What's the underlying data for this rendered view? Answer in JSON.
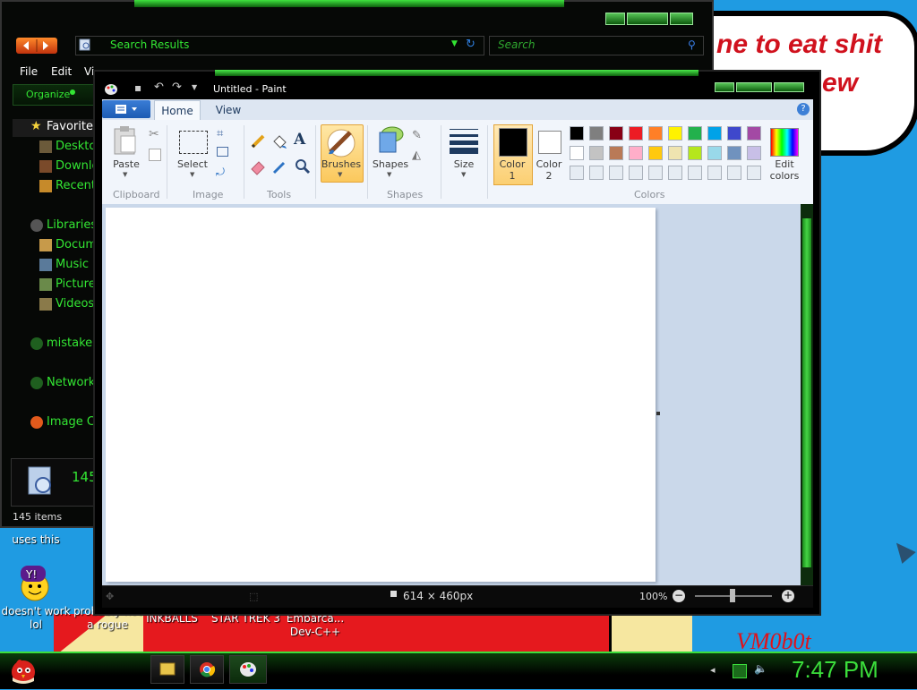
{
  "desktop": {
    "bubble_line1": "ne to eat shit",
    "bubble_line2": "ew",
    "signature": "VM0b0t",
    "icons": [
      {
        "label": "uses this",
        "icon": "generic-app-icon"
      },
      {
        "label": "doesn't work lol",
        "icon": "yahoo-messenger-icon"
      },
      {
        "label": "probably not a rogue",
        "icon": "shield-icon"
      },
      {
        "label": "INKBALLS",
        "icon": "game-icon"
      },
      {
        "label": "STAR TREK 3",
        "icon": "game-icon"
      },
      {
        "label": "Embarca... Dev-C++",
        "icon": "ide-icon"
      }
    ]
  },
  "explorer": {
    "address": "Search Results",
    "search_placeholder": "Search",
    "menu": [
      "File",
      "Edit",
      "Vi"
    ],
    "organize": "Organize",
    "nav": [
      {
        "label": "Favorites",
        "icon": "star-icon"
      },
      {
        "label": "Deskto",
        "icon": "desktop-icon"
      },
      {
        "label": "Downlo",
        "icon": "downloads-icon"
      },
      {
        "label": "Recent",
        "icon": "recent-icon"
      },
      {
        "label": "Libraries",
        "icon": "libraries-icon"
      },
      {
        "label": "Docum",
        "icon": "documents-icon"
      },
      {
        "label": "Music",
        "icon": "music-icon"
      },
      {
        "label": "Picture",
        "icon": "pictures-icon"
      },
      {
        "label": "Videos",
        "icon": "videos-icon"
      },
      {
        "label": "mistake",
        "icon": "homegroup-icon"
      },
      {
        "label": "Network",
        "icon": "network-icon"
      },
      {
        "label": "Image Ca",
        "icon": "image-capture-icon"
      }
    ],
    "details_count": "145",
    "status": "145 items"
  },
  "paint": {
    "title": "Untitled - Paint",
    "tabs": [
      "Home",
      "View"
    ],
    "help": "?",
    "groups": {
      "clipboard": "Clipboard",
      "image": "Image",
      "tools": "Tools",
      "shapes": "Shapes",
      "colors": "Colors"
    },
    "buttons": {
      "paste": "Paste",
      "select": "Select",
      "brushes": "Brushes",
      "shapes": "Shapes",
      "size": "Size",
      "color1": "Color\n1",
      "color2": "Color\n2",
      "edit_colors": "Edit\ncolors"
    },
    "palette_row1": [
      "#000000",
      "#7f7f7f",
      "#880015",
      "#ed1c24",
      "#ff7f27",
      "#fff200",
      "#22b14c",
      "#00a2e8",
      "#3f48cc",
      "#a349a4"
    ],
    "palette_row2": [
      "#ffffff",
      "#c3c3c3",
      "#b97a57",
      "#ffaec9",
      "#ffc90e",
      "#efe4b0",
      "#b5e61d",
      "#99d9ea",
      "#7092be",
      "#c8bfe7"
    ],
    "palette_row3": [
      "#e6ecf3",
      "#e6ecf3",
      "#e6ecf3",
      "#e6ecf3",
      "#e6ecf3",
      "#e6ecf3",
      "#e6ecf3",
      "#e6ecf3",
      "#e6ecf3",
      "#e6ecf3"
    ],
    "color1": "#000000",
    "color2": "#ffffff",
    "status_size": "614 × 460px",
    "zoom": "100%"
  },
  "taskbar": {
    "clock": "7:47 PM",
    "apps": [
      "explorer-icon",
      "chrome-icon",
      "paint-icon"
    ]
  }
}
